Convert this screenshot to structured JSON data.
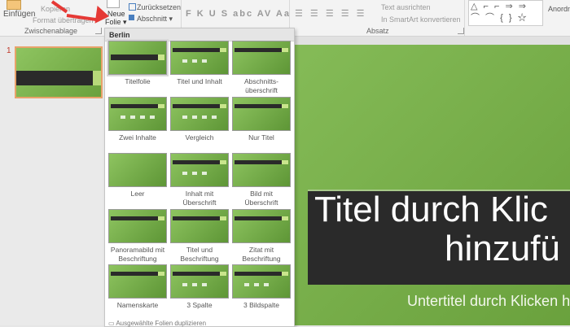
{
  "ribbon": {
    "paste_label": "Einfügen",
    "copy_label": "Kopieren",
    "format_label": "Format übertragen",
    "new_slide_line1": "Neue",
    "new_slide_line2": "Folie",
    "reset_label": "Zurücksetzen",
    "section_label": "Abschnitt",
    "clipboard_group": "Zwischenablage",
    "paragraph_group": "Absatz",
    "align_text_label": "Text ausrichten",
    "smartart_label": "In SmartArt konvertieren",
    "arrange_label": "Anordn",
    "font_tools": "F K U S abc AV Aa"
  },
  "slide_number": "1",
  "slide": {
    "title_line1": "Titel durch Klic",
    "title_line2": "hinzufü",
    "subtitle": "Untertitel durch Klicken h"
  },
  "dropdown": {
    "header": "Berlin",
    "layouts": [
      {
        "label": "Titelfolie"
      },
      {
        "label": "Titel und Inhalt"
      },
      {
        "label": "Abschnitts-\nüberschrift"
      },
      {
        "label": "Zwei Inhalte"
      },
      {
        "label": "Vergleich"
      },
      {
        "label": "Nur Titel"
      },
      {
        "label": "Leer"
      },
      {
        "label": "Inhalt mit\nÜberschrift"
      },
      {
        "label": "Bild mit\nÜberschrift"
      },
      {
        "label": "Panoramabild mit\nBeschriftung"
      },
      {
        "label": "Titel und\nBeschriftung"
      },
      {
        "label": "Zitat mit\nBeschriftung"
      },
      {
        "label": "Namenskarte"
      },
      {
        "label": "3 Spalte"
      },
      {
        "label": "3 Bildspalte"
      }
    ],
    "footer": "Ausgewählte Folien duplizieren"
  },
  "colors": {
    "accent_arrow": "#e53935",
    "slide_green": "#7cb34d",
    "band": "#2a2a2a"
  }
}
